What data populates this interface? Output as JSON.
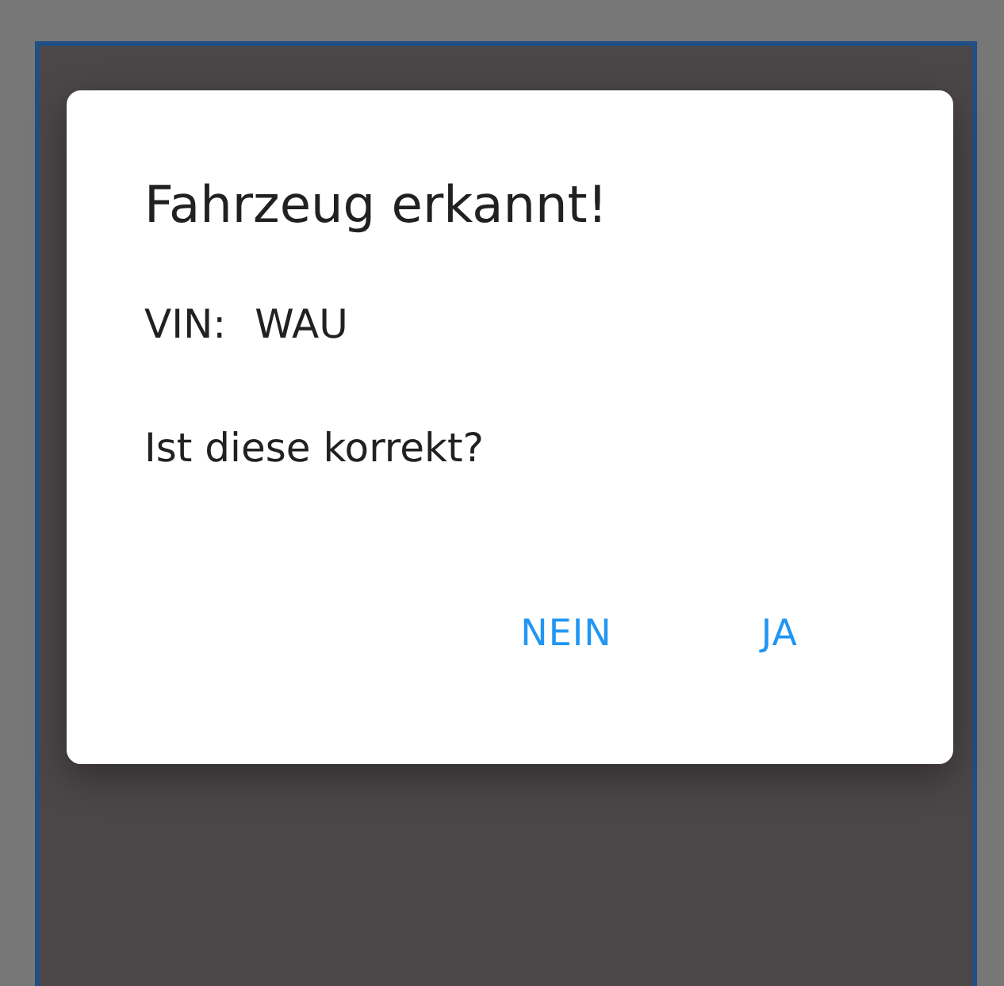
{
  "dialog": {
    "title": "Fahrzeug erkannt!",
    "vin_label": "VIN:",
    "vin_value": "WAU",
    "question": "Ist diese korrekt?",
    "buttons": [
      {
        "label": "NEIN"
      },
      {
        "label": "JA"
      }
    ]
  }
}
